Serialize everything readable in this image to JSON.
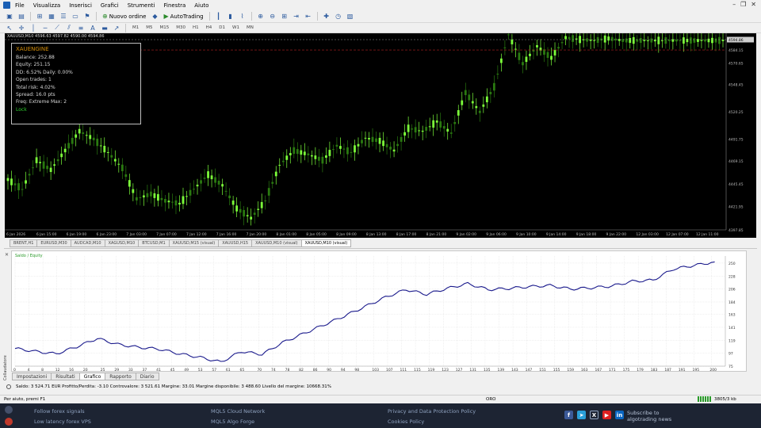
{
  "menu": [
    "File",
    "Visualizza",
    "Inserisci",
    "Grafici",
    "Strumenti",
    "Finestra",
    "Aiuto"
  ],
  "toolbar": {
    "new_order_label": "Nuovo ordine",
    "autotrading_label": "AutoTrading",
    "timeframes": [
      "M1",
      "M5",
      "M15",
      "M30",
      "H1",
      "H4",
      "D1",
      "W1",
      "MN"
    ]
  },
  "chart": {
    "header": "XAUUSD,M10  4596.63 4597.82 4590.00 4594.86",
    "price_labels": [
      "4594.86",
      "4584.15",
      "4570.65",
      "4548.45",
      "4520.25",
      "4491.75",
      "4469.15",
      "4445.45",
      "4421.95",
      "4397.85"
    ],
    "date_labels": [
      "6 Jan 2026",
      "6 Jan 15:00",
      "6 Jan 19:00",
      "6 Jan 23:00",
      "7 Jan 03:00",
      "7 Jan 07:00",
      "7 Jan 12:00",
      "7 Jan 16:00",
      "7 Jan 20:00",
      "8 Jan 01:00",
      "8 Jan 05:00",
      "8 Jan 09:00",
      "8 Jan 13:00",
      "8 Jan 17:00",
      "8 Jan 21:00",
      "9 Jan 02:00",
      "9 Jan 06:00",
      "9 Jan 10:00",
      "9 Jan 14:00",
      "9 Jan 18:00",
      "9 Jan 22:00",
      "12 Jan 03:00",
      "12 Jan 07:00",
      "12 Jan 11:00"
    ],
    "colors": {
      "bg": "#000000",
      "candle": "#7cff3a",
      "dark_candle": "#2a7a10",
      "level_line": "#b02020"
    }
  },
  "ea_panel": {
    "title": "XAUENGINE",
    "rows": [
      "Balance: 252.88",
      "Equity: 251.15",
      "DD: 6.52%  Daily: 0.00%",
      "Open trades: 1",
      "Total risk: 4.02%",
      "Spread: 16.0 pts",
      "Freq: Extreme  Max: 2"
    ],
    "lock": "Lock"
  },
  "chart_tabs": [
    "BRENT,H1",
    "EURUSD,M30",
    "AUDCAD,M10",
    "XAGUSD,M10",
    "BTCUSD,M1",
    "XAUUSD,M15 (visual)",
    "XAUUSD,H15",
    "XAUUSD,M10 (visual)",
    "XAUUSD,M10 (visual)"
  ],
  "tester": {
    "side_label": "Collaudatore",
    "legend": "Saldo / Equity",
    "tabs": [
      "Impostazioni",
      "Risultati",
      "Grafico",
      "Rapporto",
      "Diario"
    ],
    "active_tab": "Grafico",
    "summary": "Saldo: 3 524.71 EUR  Profitto/Perdita: -3.10  Controvalore: 3 521.61  Margine: 33.01  Margine disponibile: 3 488.60  Livello del margine: 10668.31%"
  },
  "status": {
    "help": "Per aiuto, premi F1",
    "profile": "ORO",
    "connection": "3805/3 kb"
  },
  "footer": {
    "left": [
      "Follow forex signals",
      "Low latency forex VPS"
    ],
    "mid": [
      "MQL5 Cloud Network",
      "MQL5 Algo Forge"
    ],
    "right": [
      "Privacy and Data Protection Policy",
      "Cookies Policy"
    ],
    "subscribe": "Subscribe to algotrading news"
  },
  "chart_data": [
    {
      "type": "line",
      "title": "",
      "series": [
        {
          "name": "",
          "x_index": [
            0,
            4,
            8,
            12,
            16,
            20,
            24,
            28,
            32,
            36,
            40,
            44,
            48,
            52,
            56,
            60,
            64,
            68,
            72,
            76,
            80,
            84,
            88,
            92,
            96,
            100,
            104,
            108,
            112,
            116,
            120,
            124,
            128,
            132,
            136,
            140,
            144,
            148,
            152,
            156,
            160,
            164,
            168,
            172,
            176,
            180,
            184,
            188,
            192,
            196,
            200
          ],
          "values": [
            4450,
            4440,
            4470,
            4460,
            4480,
            4500,
            4492,
            4478,
            4462,
            4430,
            4435,
            4428,
            4425,
            4440,
            4455,
            4444,
            4420,
            4410,
            4428,
            4465,
            4480,
            4476,
            4470,
            4485,
            4478,
            4493,
            4490,
            4480,
            4503,
            4500,
            4510,
            4498,
            4540,
            4520,
            4546,
            4600,
            4570,
            4588,
            4576,
            4597,
            4595,
            4594,
            4596,
            4594,
            4594,
            4594,
            4594,
            4594,
            4594,
            4594,
            4594
          ]
        }
      ],
      "ylim": [
        4397.85,
        4594.86
      ],
      "grid": false
    },
    {
      "type": "line",
      "title": "",
      "x_ticks": [
        0,
        4,
        8,
        12,
        16,
        20,
        25,
        29,
        33,
        37,
        41,
        45,
        49,
        53,
        57,
        61,
        65,
        70,
        74,
        78,
        82,
        86,
        90,
        94,
        98,
        103,
        107,
        111,
        115,
        119,
        123,
        127,
        131,
        135,
        139,
        143,
        147,
        151,
        155,
        159,
        163,
        167,
        171,
        175,
        179,
        183,
        187,
        191,
        195,
        200
      ],
      "y_ticks": [
        75,
        97,
        119,
        141,
        163,
        184,
        206,
        228,
        250
      ],
      "series": [
        {
          "name": "Saldo",
          "values": [
            105,
            100,
            96,
            108,
            122,
            112,
            107,
            104,
            96,
            90,
            82,
            100,
            95,
            115,
            130,
            145,
            160,
            176,
            192,
            205,
            197,
            207,
            215,
            205,
            207,
            210,
            212,
            206,
            208,
            211,
            219,
            221,
            240,
            246,
            252
          ]
        }
      ],
      "ylim": [
        75,
        262
      ],
      "grid": true
    }
  ]
}
